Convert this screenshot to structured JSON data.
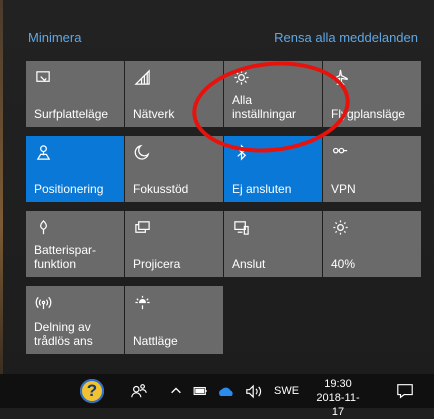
{
  "header": {
    "collapse_label": "Minimera",
    "clear_all_label": "Rensa alla meddelanden"
  },
  "tiles": [
    {
      "label": "Surfplatteläge",
      "icon": "tablet-mode-icon",
      "active": false
    },
    {
      "label": "Nätverk",
      "icon": "network-icon",
      "active": false
    },
    {
      "label": "Alla\ninställningar",
      "icon": "gear-icon",
      "active": false
    },
    {
      "label": "Flygplansläge",
      "icon": "airplane-icon",
      "active": false
    },
    {
      "label": "Positionering",
      "icon": "location-icon",
      "active": true
    },
    {
      "label": "Fokusstöd",
      "icon": "moon-icon",
      "active": false
    },
    {
      "label": "Ej ansluten",
      "icon": "bluetooth-icon",
      "active": true
    },
    {
      "label": "VPN",
      "icon": "vpn-icon",
      "active": false
    },
    {
      "label": "Batterispar-\nfunktion",
      "icon": "battery-saver-icon",
      "active": false
    },
    {
      "label": "Projicera",
      "icon": "project-icon",
      "active": false
    },
    {
      "label": "Anslut",
      "icon": "connect-icon",
      "active": false
    },
    {
      "label": "40%",
      "icon": "brightness-icon",
      "active": false
    },
    {
      "label": "Delning av\ntrådlös ans",
      "icon": "hotspot-icon",
      "active": false
    },
    {
      "label": "Nattläge",
      "icon": "night-light-icon",
      "active": false
    }
  ],
  "taskbar": {
    "language": "SWE",
    "time": "19:30",
    "date": "2018-11-17"
  },
  "colors": {
    "accent": "#0a78d7",
    "tile": "#6a6a6a",
    "link": "#5fa8e6",
    "annotation": "#e8120c"
  }
}
